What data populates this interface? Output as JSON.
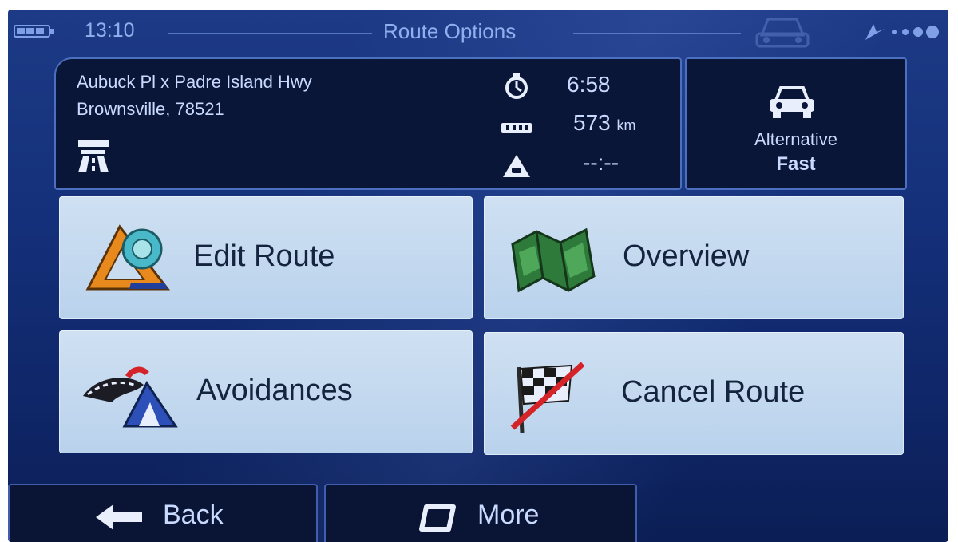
{
  "status_bar": {
    "time": "13:10",
    "title": "Route Options",
    "icons": [
      "battery-icon",
      "car-watermark-icon",
      "gps-signal-icon"
    ]
  },
  "route_info": {
    "address_line1": "Aubuck Pl x Padre Island Hwy",
    "address_line2": "Brownsville, 78521",
    "road_icon": "motorway-icon",
    "duration": "6:58",
    "duration_icon": "stopwatch-icon",
    "distance_value": "573",
    "distance_unit": "km",
    "distance_icon": "distance-ruler-icon",
    "delay": "--:--",
    "delay_icon": "traffic-warning-icon"
  },
  "route_type": {
    "icon": "car-icon",
    "label": "Alternative",
    "value": "Fast"
  },
  "menu": {
    "edit_route": {
      "label": "Edit Route",
      "icon": "ruler-triangle-icon"
    },
    "overview": {
      "label": "Overview",
      "icon": "folded-map-icon"
    },
    "avoidances": {
      "label": "Avoidances",
      "icon": "road-avoid-icon"
    },
    "cancel_route": {
      "label": "Cancel Route",
      "icon": "crossed-flag-icon"
    }
  },
  "bottom_bar": {
    "back_label": "Back",
    "more_label": "More"
  },
  "colors": {
    "background": "#14307a",
    "panel": "#0a1638",
    "button": "#c4d9ef",
    "text_light": "#c9d9ff",
    "text_dark": "#14243f"
  }
}
